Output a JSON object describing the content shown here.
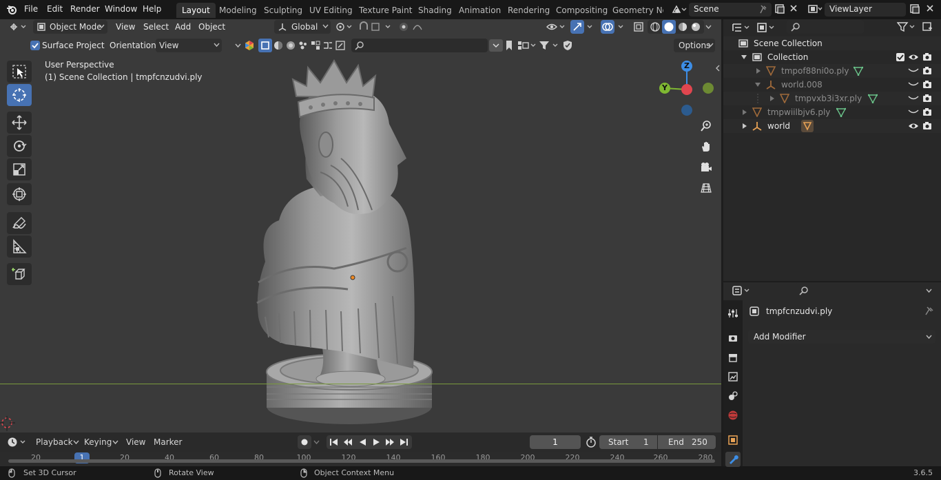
{
  "topbar": {
    "menus": [
      "File",
      "Edit",
      "Render",
      "Window",
      "Help"
    ],
    "workspace_tabs": [
      "Layout",
      "Modeling",
      "Sculpting",
      "UV Editing",
      "Texture Paint",
      "Shading",
      "Animation",
      "Rendering",
      "Compositing",
      "Geometry Noc"
    ],
    "active_tab": "Layout",
    "scene_label": "Scene",
    "view_layer_label": "ViewLayer"
  },
  "viewport_header": {
    "mode": "Object Mode",
    "menus": [
      "View",
      "Select",
      "Add",
      "Object"
    ],
    "transform_orientation": "Global",
    "options_label": "Options"
  },
  "tool_settings": {
    "surface_project_label": "Surface Project",
    "surface_project_checked": true,
    "orientation_label": "Orientation:",
    "orientation_value": "View"
  },
  "viewport": {
    "perspective_label": "User Perspective",
    "collection_label": "(1) Scene Collection | tmpfcnzudvi.ply",
    "gizmo_axes": [
      "Z",
      "Y"
    ]
  },
  "timeline": {
    "playback_label": "Playback",
    "keying_label": "Keying",
    "view_label": "View",
    "marker_label": "Marker",
    "current_frame": "1",
    "start_label": "Start",
    "start_value": "1",
    "end_label": "End",
    "end_value": "250",
    "ruler_ticks": [
      "20",
      "1",
      "20",
      "40",
      "60",
      "80",
      "100",
      "120",
      "140",
      "160",
      "180",
      "200",
      "220",
      "240",
      "260",
      "280"
    ]
  },
  "statusbar": {
    "left_hint": "Set 3D Cursor",
    "middle_hint": "Rotate View",
    "right_hint": "Object Context Menu",
    "version": "3.6.5"
  },
  "outliner": {
    "root": "Scene Collection",
    "rows": [
      {
        "label": "Collection",
        "type": "collection"
      },
      {
        "label": "tmpof88ni0o.ply",
        "type": "mesh"
      },
      {
        "label": "world.008",
        "type": "empty"
      },
      {
        "label": "tmpvxb3i3xr.ply",
        "type": "mesh"
      },
      {
        "label": "tmpwiilbjv6.ply",
        "type": "mesh"
      },
      {
        "label": "world",
        "type": "empty"
      }
    ]
  },
  "properties": {
    "object_name": "tmpfcnzudvi.ply",
    "add_modifier_label": "Add Modifier"
  },
  "colors": {
    "accent_blue": "#4772b3",
    "axis_x": "#e0464f",
    "axis_y": "#7fb832",
    "axis_z": "#3d8ee6",
    "mesh_green": "#6bc48a",
    "empty_orange": "#e8a255"
  }
}
